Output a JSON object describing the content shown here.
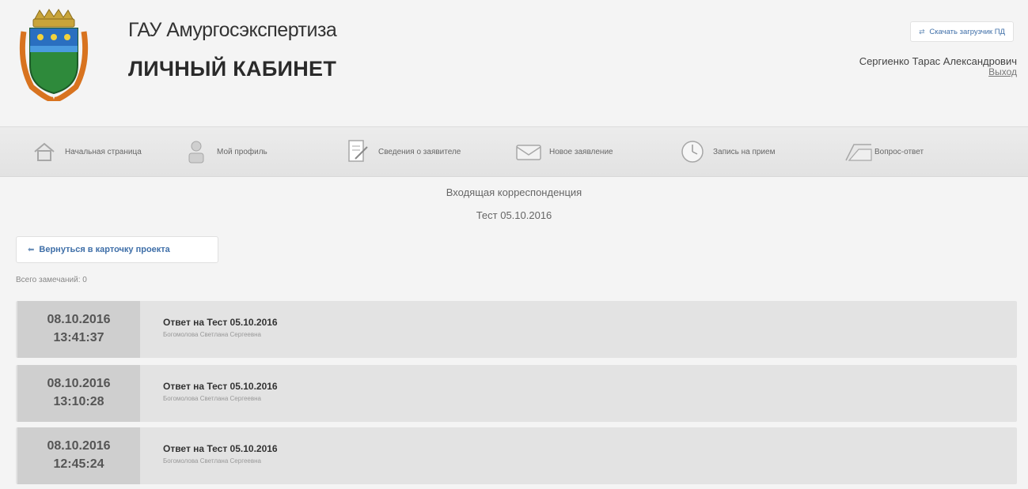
{
  "header": {
    "org_name": "ГАУ Амургосэкспертиза",
    "cabinet_title": "ЛИЧНЫЙ КАБИНЕТ",
    "download_label": "Скачать загрузчик ПД",
    "user_name": "Сергиенко Тарас Александрович",
    "logout_label": "Выход"
  },
  "nav": {
    "items": [
      {
        "label": "Начальная страница",
        "icon": "home-icon"
      },
      {
        "label": "Мой профиль",
        "icon": "profile-icon"
      },
      {
        "label": "Сведения о заявителе",
        "icon": "document-edit-icon"
      },
      {
        "label": "Новое заявление",
        "icon": "envelope-icon"
      },
      {
        "label": "Запись на прием",
        "icon": "clock-icon"
      },
      {
        "label": "Вопрос-ответ",
        "icon": "qa-icon"
      }
    ]
  },
  "main": {
    "section_title": "Входящая корреспонденция",
    "project_name": "Тест 05.10.2016",
    "back_label": "Вернуться в карточку проекта",
    "total_label": "Всего замечаний: 0"
  },
  "messages": [
    {
      "date": "08.10.2016",
      "time": "13:41:37",
      "title": "Ответ на Тест 05.10.2016",
      "author": "Богомолова Светлана Сергеевна"
    },
    {
      "date": "08.10.2016",
      "time": "13:10:28",
      "title": "Ответ на Тест 05.10.2016",
      "author": "Богомолова Светлана Сергеевна"
    },
    {
      "date": "08.10.2016",
      "time": "12:45:24",
      "title": "Ответ на Тест 05.10.2016",
      "author": "Богомолова Светлана Сергеевна"
    }
  ],
  "colors": {
    "accent": "#3f6fa8",
    "background": "#f4f4f4",
    "row_bg": "#e3e3e3",
    "date_bg": "#cfcfcf"
  }
}
